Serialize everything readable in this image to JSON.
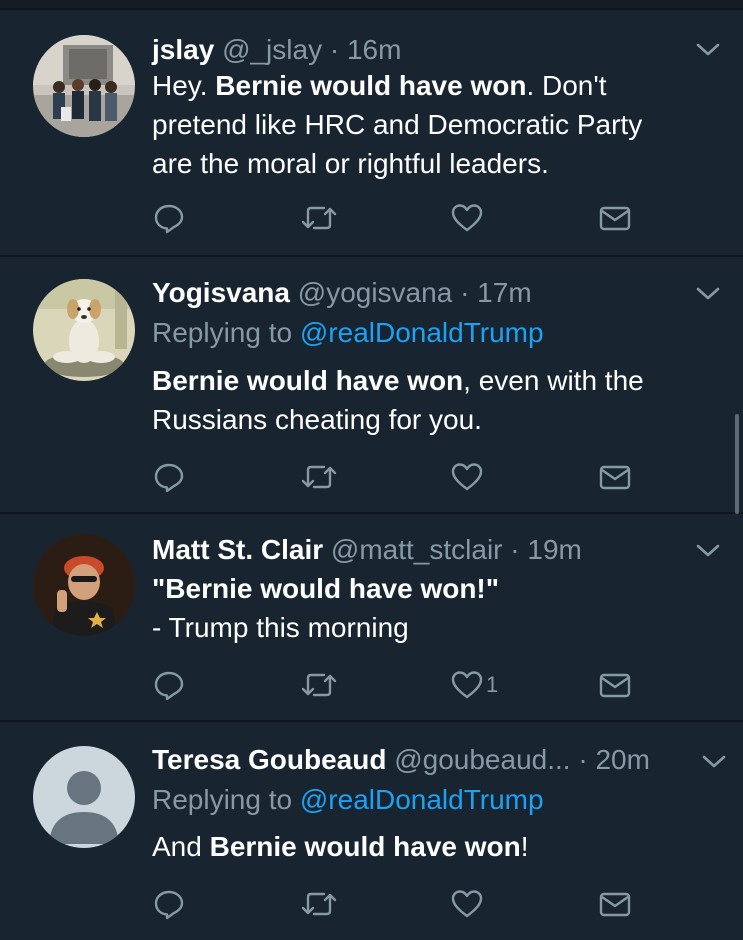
{
  "tweets": [
    {
      "name": "jslay",
      "handle": "@_jslay",
      "separator": "·",
      "time": "16m",
      "avatar_icon": "photo-avatar-group",
      "replying_label": "",
      "replying_mention": "",
      "body": {
        "line1_pre": "Hey. ",
        "line1_bold": "Bernie would have won",
        "line1_post": ". Don't",
        "line2": "pretend like HRC and Democratic Party",
        "line3": "are the moral or rightful leaders."
      },
      "likes": ""
    },
    {
      "name": "Yogisvana",
      "handle": "@yogisvana",
      "separator": "·",
      "time": "17m",
      "avatar_icon": "photo-avatar-dog-meditating",
      "replying_label": "Replying to ",
      "replying_mention": "@realDonaldTrump",
      "body": {
        "line1_bold": "Bernie would have won",
        "line1_post": ", even with the",
        "line2": "Russians cheating for you."
      },
      "likes": ""
    },
    {
      "name": "Matt St. Clair",
      "handle": "@matt_stclair",
      "separator": "·",
      "time": "19m",
      "avatar_icon": "photo-avatar-person",
      "replying_label": "",
      "replying_mention": "",
      "body": {
        "line1": "\"Bernie would have won!\"",
        "line2": "- Trump this morning"
      },
      "likes": "1"
    },
    {
      "name": "Teresa Goubeaud",
      "handle": "@goubeaud...",
      "separator": "·",
      "time": "20m",
      "avatar_icon": "default-avatar-icon",
      "replying_label": "Replying to ",
      "replying_mention": "@realDonaldTrump",
      "body": {
        "line1_pre": "And ",
        "line1_bold": "Bernie would have won",
        "line1_post": "!"
      },
      "likes": ""
    }
  ],
  "colors": {
    "background": "#182430",
    "divider": "#0f161d",
    "secondary_text": "#8899a6",
    "mention": "#1da1f2",
    "icon": "#8899a6"
  },
  "icons": [
    "reply-icon",
    "retweet-icon",
    "like-icon",
    "direct-message-icon",
    "chevron-down-icon"
  ]
}
